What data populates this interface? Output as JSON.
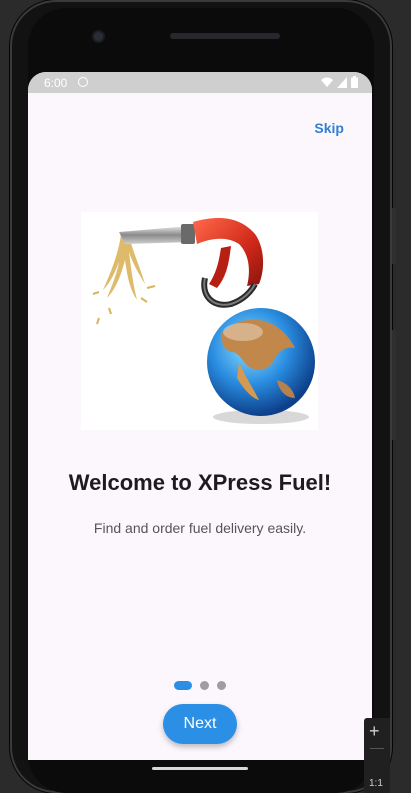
{
  "status_bar": {
    "time": "6:00"
  },
  "onboarding": {
    "skip_label": "Skip",
    "title": "Welcome to XPress Fuel!",
    "subtitle": "Find and order fuel delivery easily.",
    "next_label": "Next",
    "page_count": 3,
    "current_page": 1
  },
  "emulator": {
    "zoom_in_label": "+",
    "actual_size_label": "1:1"
  },
  "colors": {
    "accent": "#2b8fe6",
    "background": "#fcf7fd",
    "title": "#1c1b1f"
  }
}
